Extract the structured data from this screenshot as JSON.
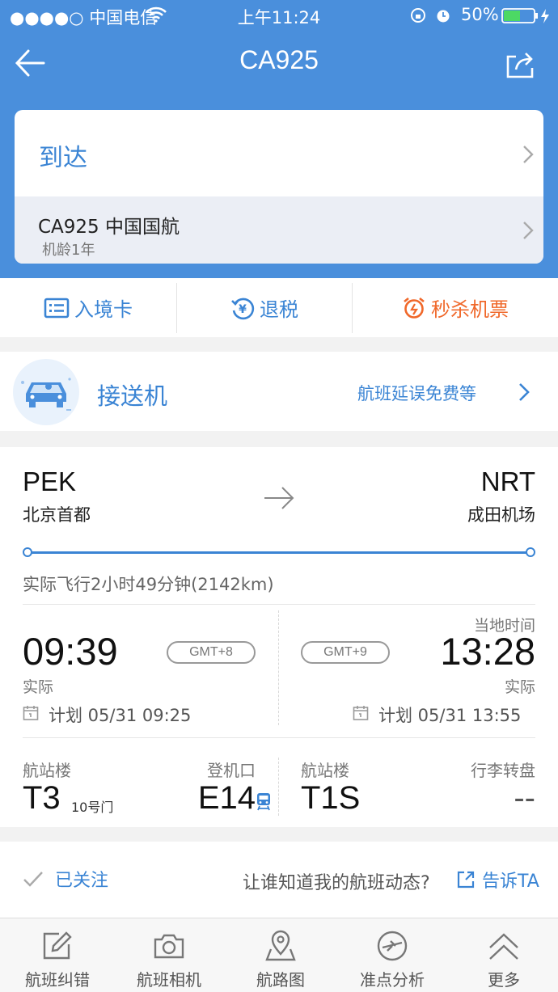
{
  "status_bar": {
    "carrier": "●●●●○ 中国电信",
    "time": "上午11:24",
    "battery": "50%"
  },
  "header": {
    "title": "CA925"
  },
  "arrival_card": {
    "title": "到达",
    "flight": "CA925  中国国航",
    "plane_age": "机龄1年"
  },
  "actions": [
    {
      "label": "入境卡",
      "color": "#3a84d4"
    },
    {
      "label": "退税",
      "color": "#3a84d4"
    },
    {
      "label": "秒杀机票",
      "color": "#f0682a"
    }
  ],
  "transfer": {
    "title": "接送机",
    "promo": "航班延误免费等"
  },
  "route": {
    "from_code": "PEK",
    "from_city": "北京首都",
    "to_code": "NRT",
    "to_city": "成田机场",
    "progress": 1.0,
    "duration": "实际飞行2小时49分钟(2142km)"
  },
  "departure": {
    "time": "09:39",
    "tz": "GMT+8",
    "status": "实际",
    "plan": "计划 05/31 09:25",
    "terminal_label": "航站楼",
    "terminal": "T3",
    "gate_note": "10号门",
    "gate_label": "登机口",
    "gate": "E14"
  },
  "arrival": {
    "local_label": "当地时间",
    "time": "13:28",
    "tz": "GMT+9",
    "status": "实际",
    "plan": "计划 05/31 13:55",
    "terminal_label": "航站楼",
    "terminal": "T1S",
    "baggage_label": "行李转盘",
    "baggage": "--"
  },
  "follow": {
    "status": "已关注",
    "prompt": "让谁知道我的航班动态?",
    "tell": "告诉TA"
  },
  "tabs": [
    {
      "label": "航班纠错",
      "icon": "edit-icon"
    },
    {
      "label": "航班相机",
      "icon": "camera-icon"
    },
    {
      "label": "航路图",
      "icon": "map-icon"
    },
    {
      "label": "准点分析",
      "icon": "punctuality-icon"
    },
    {
      "label": "更多",
      "icon": "chevron-up-icon"
    }
  ]
}
